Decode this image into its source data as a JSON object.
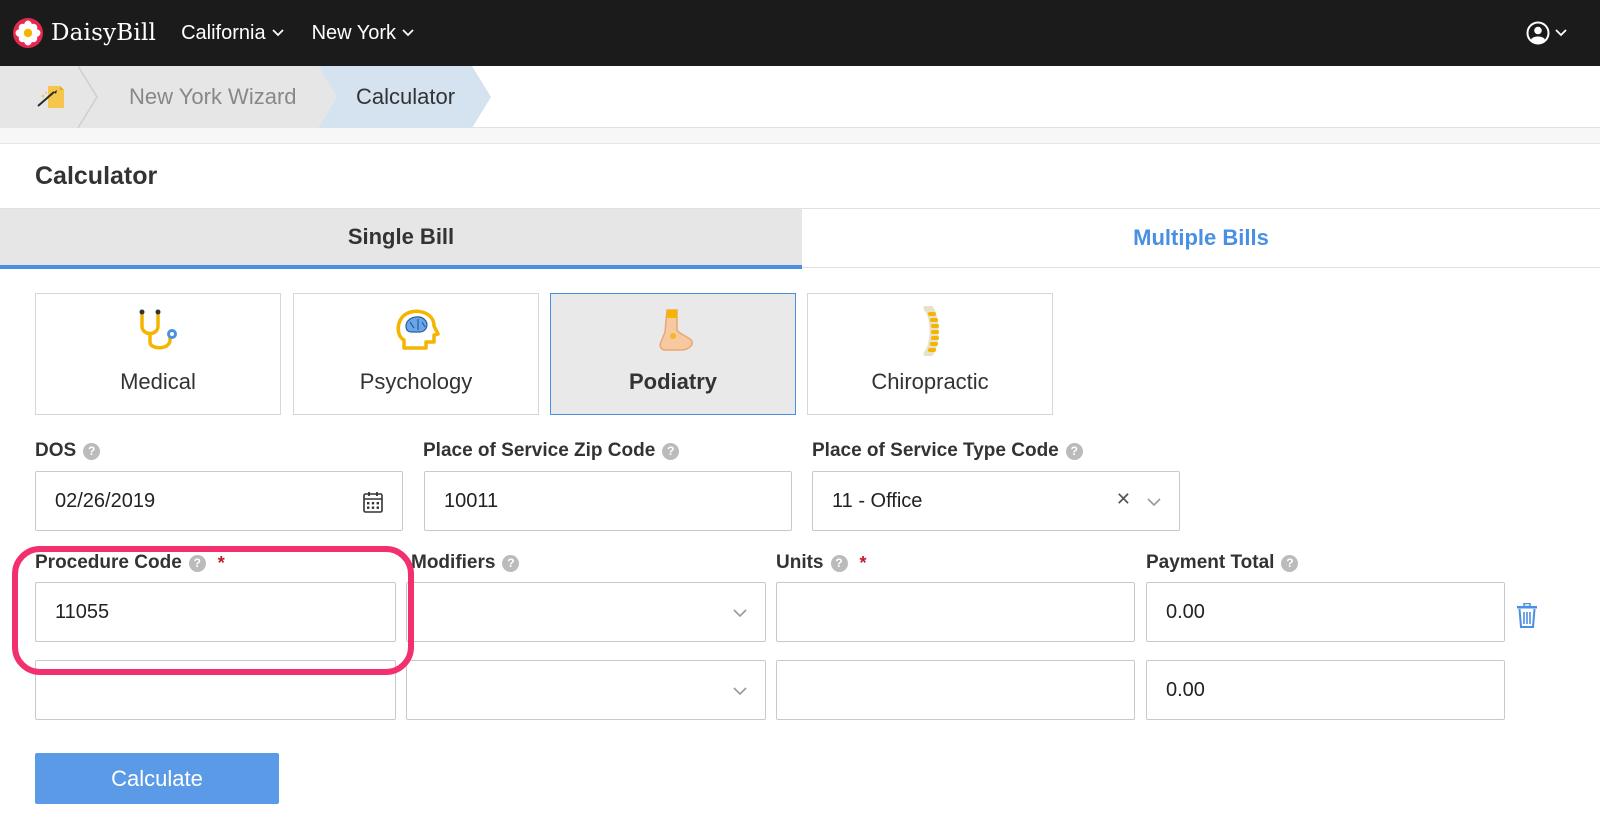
{
  "brand": {
    "name": "DaisyBill"
  },
  "nav": {
    "california": "California",
    "new_york": "New York"
  },
  "breadcrumb": {
    "wizard": "New York Wizard",
    "current": "Calculator"
  },
  "page": {
    "title": "Calculator"
  },
  "tabs": {
    "single": "Single Bill",
    "multiple": "Multiple Bills",
    "active": "Single Bill"
  },
  "services": [
    {
      "label": "Medical",
      "icon": "stethoscope-icon"
    },
    {
      "label": "Psychology",
      "icon": "brain-icon"
    },
    {
      "label": "Podiatry",
      "icon": "foot-icon",
      "selected": true
    },
    {
      "label": "Chiropractic",
      "icon": "spine-icon"
    }
  ],
  "form": {
    "dos": {
      "label": "DOS",
      "value": "02/26/2019"
    },
    "zip": {
      "label": "Place of Service Zip Code",
      "value": "10011"
    },
    "type_code": {
      "label": "Place of Service Type Code",
      "value": "11 - Office"
    },
    "procedure": {
      "label": "Procedure Code",
      "value": "11055"
    },
    "modifiers": {
      "label": "Modifiers"
    },
    "units": {
      "label": "Units"
    },
    "payment": {
      "label": "Payment Total"
    },
    "rows": [
      {
        "procedure": "11055",
        "modifiers": "",
        "units": "",
        "payment": "0.00"
      },
      {
        "procedure": "",
        "modifiers": "",
        "units": "",
        "payment": "0.00"
      }
    ],
    "required_mark": "*",
    "help_mark": "?"
  },
  "actions": {
    "calculate": "Calculate"
  },
  "colors": {
    "accent": "#4a90e2",
    "button": "#5b9ae6",
    "highlight": "#f2306e",
    "navbar": "#1b1b1b"
  }
}
